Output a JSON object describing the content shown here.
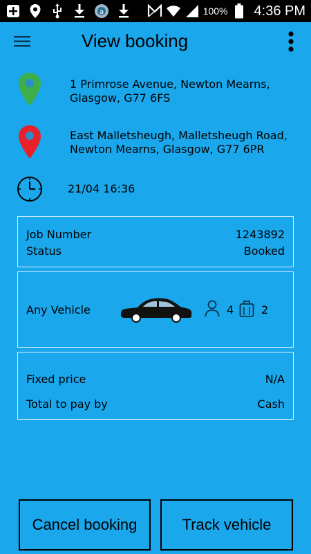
{
  "status_bar": {
    "left_icons": [
      "add-box-icon",
      "location-icon",
      "usb-icon",
      "download-icon",
      "app-notification-icon",
      "download-icon"
    ],
    "right_icons": [
      "nfc-icon",
      "wifi-icon",
      "signal-icon",
      "battery-icon"
    ],
    "battery": "100%",
    "time": "4:36 PM"
  },
  "appbar": {
    "title": "View booking",
    "menu_icon": "hamburger-menu-icon",
    "more_icon": "more-vertical-icon"
  },
  "pickup": {
    "address_line1": "1 Primrose Avenue, Newton Mearns,",
    "address_line2": "Glasgow, G77 6FS",
    "icon": "pickup-pin-icon",
    "color": "#3dae4a"
  },
  "dropoff": {
    "address_line1": "East Malletsheugh, Malletsheugh Road,",
    "address_line2": "Newton Mearns, Glasgow, G77 6PR",
    "icon": "dropoff-pin-icon",
    "color": "#e8202a"
  },
  "pickup_time": {
    "value": "21/04 16:36",
    "icon": "clock-icon"
  },
  "job": {
    "job_number_label": "Job Number",
    "job_number": "1243892",
    "status_label": "Status",
    "status": "Booked"
  },
  "vehicle": {
    "type": "Any Vehicle",
    "passengers": "4",
    "luggage": "2",
    "icons": [
      "car-icon",
      "passenger-icon",
      "luggage-icon"
    ]
  },
  "payment": {
    "price_label": "Fixed price",
    "price": "N/A",
    "pay_by_label": "Total to pay by",
    "pay_by": "Cash"
  },
  "actions": {
    "cancel": "Cancel booking",
    "track": "Track vehicle"
  },
  "colors": {
    "background": "#1aa7ec",
    "status_bar": "#000000"
  }
}
